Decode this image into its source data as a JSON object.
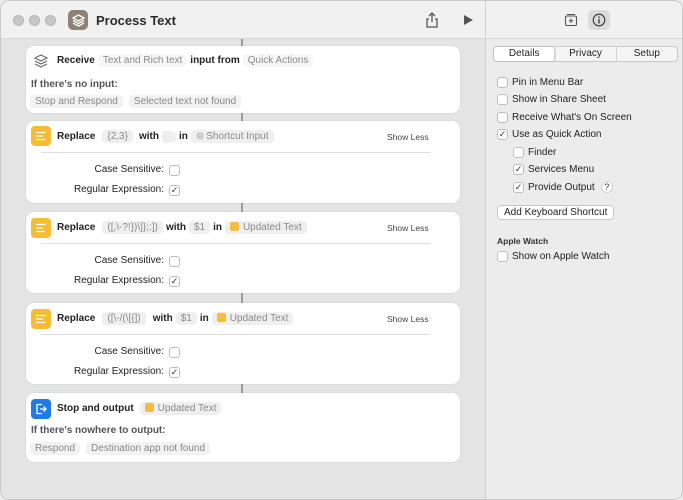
{
  "window": {
    "title": "Process Text"
  },
  "editor": {
    "receive": {
      "label": "Receive",
      "types": "Text and Rich text",
      "input_from_label": "input from",
      "source": "Quick Actions",
      "no_input_heading": "If there's no input:",
      "no_input_action": "Stop and Respond",
      "no_input_message": "Selected text not found"
    },
    "actions": [
      {
        "label": "Replace",
        "pattern": "{2,3}",
        "with_label": "with",
        "replacement": "",
        "in_label": "in",
        "target": "Shortcut Input",
        "show_less": "Show Less",
        "case_sensitive_label": "Case Sensitive:",
        "case_sensitive": false,
        "regex_label": "Regular Expression:",
        "regex": true
      },
      {
        "label": "Replace",
        "pattern": "([,\\-?!})\\]};:])",
        "with_label": "with",
        "replacement": "$1",
        "in_label": "in",
        "target": "Updated Text",
        "show_less": "Show Less",
        "case_sensitive_label": "Case Sensitive:",
        "case_sensitive": false,
        "regex_label": "Regular Expression:",
        "regex": true
      },
      {
        "label": "Replace",
        "pattern": "([\\-/(\\[{])",
        "with_label": "with",
        "replacement": "$1",
        "in_label": "in",
        "target": "Updated Text",
        "show_less": "Show Less",
        "case_sensitive_label": "Case Sensitive:",
        "case_sensitive": false,
        "regex_label": "Regular Expression:",
        "regex": true
      }
    ],
    "stop_output": {
      "label": "Stop and output",
      "target": "Updated Text",
      "nowhere_heading": "If there's nowhere to output:",
      "nowhere_action": "Respond",
      "nowhere_message": "Destination app not found"
    }
  },
  "inspector": {
    "tabs": [
      {
        "label": "Details",
        "active": true
      },
      {
        "label": "Privacy",
        "active": false
      },
      {
        "label": "Setup",
        "active": false
      }
    ],
    "options": [
      {
        "label": "Pin in Menu Bar",
        "checked": false
      },
      {
        "label": "Show in Share Sheet",
        "checked": false
      },
      {
        "label": "Receive What's On Screen",
        "checked": false
      },
      {
        "label": "Use as Quick Action",
        "checked": true
      }
    ],
    "quick_action_options": [
      {
        "label": "Finder",
        "checked": false
      },
      {
        "label": "Services Menu",
        "checked": true
      },
      {
        "label": "Provide Output",
        "checked": true
      }
    ],
    "help_symbol": "?",
    "add_shortcut_button": "Add Keyboard Shortcut",
    "apple_watch_heading": "Apple Watch",
    "apple_watch_option": {
      "label": "Show on Apple Watch",
      "checked": false
    }
  },
  "colors": {
    "action_yellow": "#f5bd33",
    "action_blue": "#1e7be7",
    "variable_badge": "#f3bf3a"
  },
  "icons": {
    "share": "share-icon",
    "run": "play-icon",
    "add_action": "add-library-icon",
    "info": "info-icon",
    "receive": "layers-icon",
    "replace": "text-lines-icon",
    "stop": "exit-icon"
  }
}
